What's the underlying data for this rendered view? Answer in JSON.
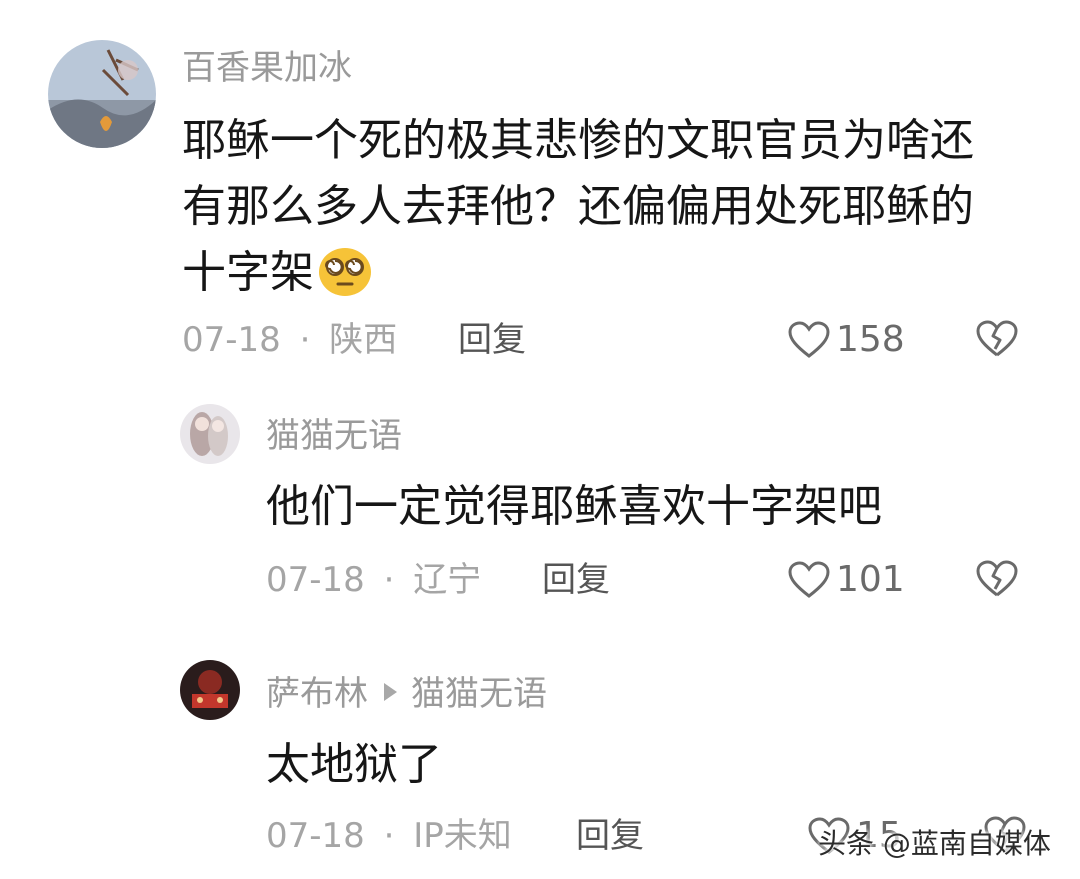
{
  "comments": [
    {
      "username": "百香果加冰",
      "text_lines": [
        "耶稣一个死的极其悲惨的文职官员为啥还",
        "有那么多人去拜他？还偏偏用处死耶稣的",
        "十字架"
      ],
      "emoji": "dizzy-face-emoji",
      "date": "07-18",
      "location": "陕西",
      "reply_label": "回复",
      "likes": "158"
    },
    {
      "username": "猫猫无语",
      "text_lines": [
        "他们一定觉得耶稣喜欢十字架吧"
      ],
      "date": "07-18",
      "location": "辽宁",
      "reply_label": "回复",
      "likes": "101"
    },
    {
      "username": "萨布林",
      "reply_to": "猫猫无语",
      "text_lines": [
        "太地狱了"
      ],
      "date": "07-18",
      "location": "IP未知",
      "reply_label": "回复",
      "likes": "15"
    }
  ],
  "separator": "·",
  "watermark": "头条 @蓝南自媒体",
  "icons": [
    "heart-outline-icon",
    "broken-heart-icon",
    "reply-arrow-icon"
  ],
  "colors": {
    "username": "#9a9a9a",
    "text": "#161616",
    "meta": "#a5a5a5",
    "icon": "#6a6a6a"
  }
}
